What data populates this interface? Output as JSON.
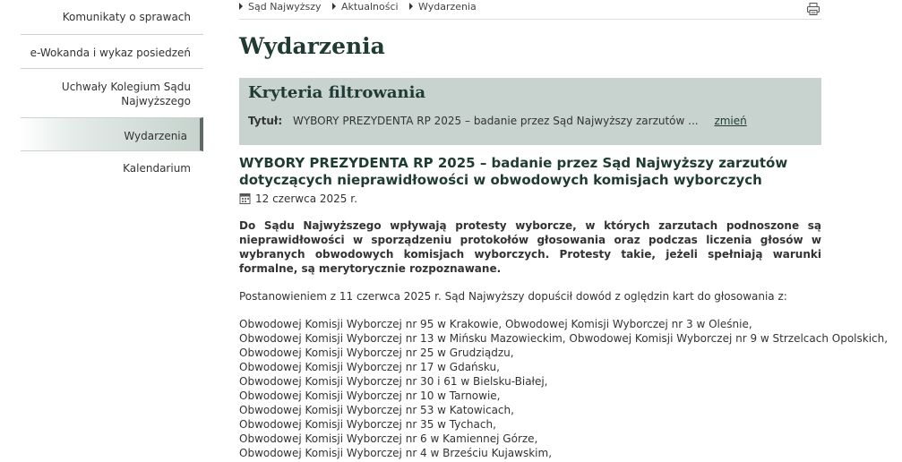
{
  "sidebar": {
    "items": [
      {
        "label": "Komunikaty o sprawach"
      },
      {
        "label": "e-Wokanda i wykaz posiedzeń"
      },
      {
        "label": "Uchwały Kolegium Sądu Najwyższego"
      },
      {
        "label": "Wydarzenia"
      },
      {
        "label": "Kalendarium"
      }
    ]
  },
  "breadcrumb": [
    "Sąd Najwyższy",
    "Aktualności",
    "Wydarzenia"
  ],
  "icons": {
    "print": "printer-icon",
    "date": "calendar-icon"
  },
  "page_title": "Wydarzenia",
  "filter": {
    "title": "Kryteria filtrowania",
    "label": "Tytuł:",
    "value": "WYBORY PREZYDENTA RP 2025 – badanie przez Sąd Najwyższy zarzutów ...",
    "change": "zmień"
  },
  "article": {
    "title": "WYBORY PREZYDENTA RP 2025 – badanie przez Sąd Najwyższy zarzutów dotyczących nieprawidłowości w obwodowych komisjach wyborczych",
    "date": "12 czerwca 2025 r.",
    "lead": "Do Sądu Najwyższego wpływają protesty wyborcze, w których zarzutach podnoszone są nieprawidłowości w sporządzeniu protokołów głosowania oraz podczas liczenia głosów w wybranych obwodowych komisjach wyborczych.  Protesty takie, jeżeli spełniają warunki formalne, są merytorycznie rozpoznawane.",
    "para": "Postanowieniem z 11 czerwca 2025 r. Sąd Najwyższy dopuścił dowód z oględzin kart do głosowania z:",
    "list": [
      "Obwodowej Komisji Wyborczej nr 95 w Krakowie, Obwodowej Komisji Wyborczej nr 3 w Oleśnie,",
      "Obwodowej Komisji Wyborczej nr 13 w Mińsku Mazowieckim, Obwodowej Komisji Wyborczej nr 9 w Strzelcach Opolskich,",
      "Obwodowej Komisji Wyborczej nr 25 w Grudziądzu,",
      "Obwodowej Komisji Wyborczej nr 17 w Gdańsku,",
      "Obwodowej Komisji Wyborczej nr 30 i 61 w Bielsku-Białej,",
      "Obwodowej Komisji Wyborczej nr 10 w Tarnowie,",
      "Obwodowej Komisji Wyborczej nr 53 w Katowicach,",
      "Obwodowej Komisji Wyborczej nr 35 w Tychach,",
      "Obwodowej Komisji Wyborczej nr 6 w Kamiennej Górze,",
      "Obwodowej Komisji Wyborczej nr 4 w Brześciu Kujawskim,"
    ]
  },
  "colors": {
    "accent": "#1f3b33",
    "filter_bg": "#c8d3d0",
    "sidebar_active_border": "#5f6a66"
  }
}
